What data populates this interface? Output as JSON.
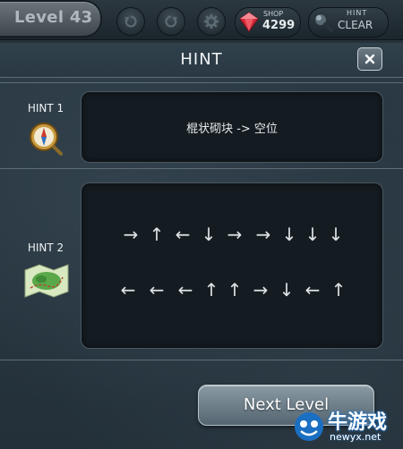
{
  "topbar": {
    "level": "Level 43",
    "shop_label": "SHOP",
    "shop_count": "4299",
    "hint_label": "HINT",
    "hint_clear": "CLEAR"
  },
  "icons": {
    "undo": "undo-icon",
    "restart": "restart-icon",
    "settings": "gear-icon",
    "gem": "ruby-gem-icon",
    "magnifier": "magnifier-icon",
    "close": "close-icon",
    "compass": "compass-icon",
    "map": "treasure-map-icon"
  },
  "modal": {
    "title": "HINT",
    "hint1_label": "HINT 1",
    "hint1_text": "棍状砌块 -> 空位",
    "hint2_label": "HINT 2",
    "hint2_rows": [
      [
        "→",
        "↑",
        "←",
        "↓",
        "→",
        "→",
        "↓",
        "↓",
        "↓"
      ],
      [
        "←",
        "←",
        "←",
        "↑",
        "↑",
        "→",
        "↓",
        "←",
        "↑"
      ]
    ],
    "next_button": "Next Level"
  },
  "watermark": {
    "main": "牛游戏",
    "sub": "newyx.net"
  },
  "colors": {
    "background": "#26323a",
    "panel_box": "#141c22",
    "gem_red": "#d22a3a"
  }
}
